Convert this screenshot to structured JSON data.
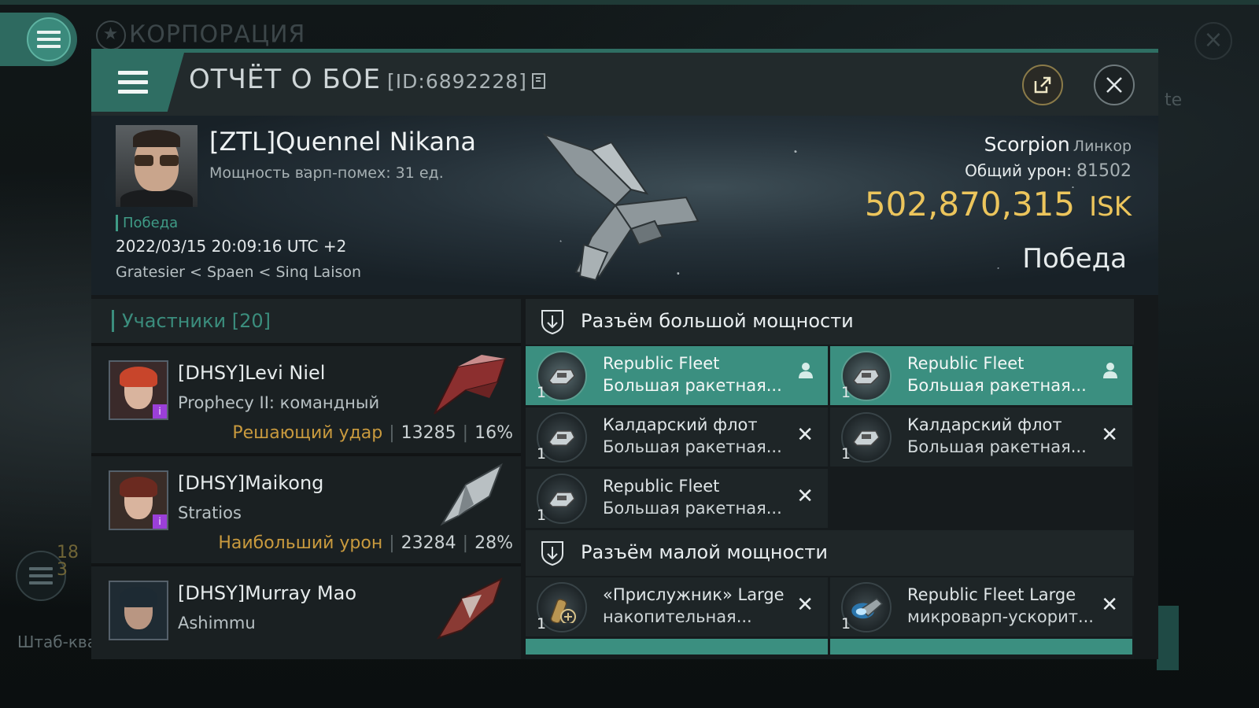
{
  "background": {
    "corp_label": "КОРПОРАЦИЯ",
    "side_text": "te",
    "left_bottom_text": "Штаб-ква",
    "left_numbers": "18\n3"
  },
  "dialog": {
    "title": "ОТЧЁТ О БОЕ",
    "report_id": "[ID:6892228]"
  },
  "victim": {
    "name": "[ZTL]Quennel Nikana",
    "warp_strength": "Мощность варп-помех: 31 ед.",
    "status": "Победа",
    "datetime": "2022/03/15 20:09:16 UTC +2",
    "location": "Gratesier < Spaen < Sinq Laison",
    "ship_name": "Scorpion",
    "ship_class": "Линкор",
    "total_damage_label": "Общий урон:",
    "total_damage": "81502",
    "isk_value": "502,870,315",
    "isk_currency": "ISK",
    "result": "Победа"
  },
  "participants": {
    "header": "Участники [20]",
    "rows": [
      {
        "name": "[DHSY]Levi Niel",
        "ship": "Prophecy II: командный",
        "tag": "Решающий удар",
        "damage": "13285",
        "percent": "16%",
        "hair_color": "#c8452b"
      },
      {
        "name": "[DHSY]Maikong",
        "ship": "Stratios",
        "tag": "Наибольший урон",
        "damage": "23284",
        "percent": "28%",
        "hair_color": "#6b2a20"
      },
      {
        "name": "[DHSY]Murray Mao",
        "ship": "Ashimmu",
        "tag": "",
        "damage": "",
        "percent": "",
        "hair_color": "#1d2a33"
      }
    ]
  },
  "fitting": {
    "high_slots_label": "Разъём большой мощности",
    "low_slots_label": "Разъём малой мощности",
    "high_slots": [
      {
        "line1": "Republic Fleet",
        "line2": "Большая ракетная...",
        "qty": "1",
        "state": "dropped"
      },
      {
        "line1": "Republic Fleet",
        "line2": "Большая ракетная...",
        "qty": "1",
        "state": "dropped"
      },
      {
        "line1": "Калдарский флот",
        "line2": "Большая ракетная...",
        "qty": "1",
        "state": "destroyed"
      },
      {
        "line1": "Калдарский флот",
        "line2": "Большая ракетная...",
        "qty": "1",
        "state": "destroyed"
      },
      {
        "line1": "Republic Fleet",
        "line2": "Большая ракетная...",
        "qty": "1",
        "state": "destroyed"
      }
    ],
    "low_slots": [
      {
        "line1": "«Прислужник» Large",
        "line2": "накопительная...",
        "qty": "1",
        "state": "destroyed"
      },
      {
        "line1": "Republic Fleet Large",
        "line2": "микроварп-ускорит...",
        "qty": "1",
        "state": "destroyed"
      }
    ],
    "destroyed_mark": "✕",
    "dropped_mark": "👤"
  },
  "colors": {
    "accent": "#3b8f80",
    "gold": "#ecc55c",
    "tag": "#c99a3e"
  }
}
